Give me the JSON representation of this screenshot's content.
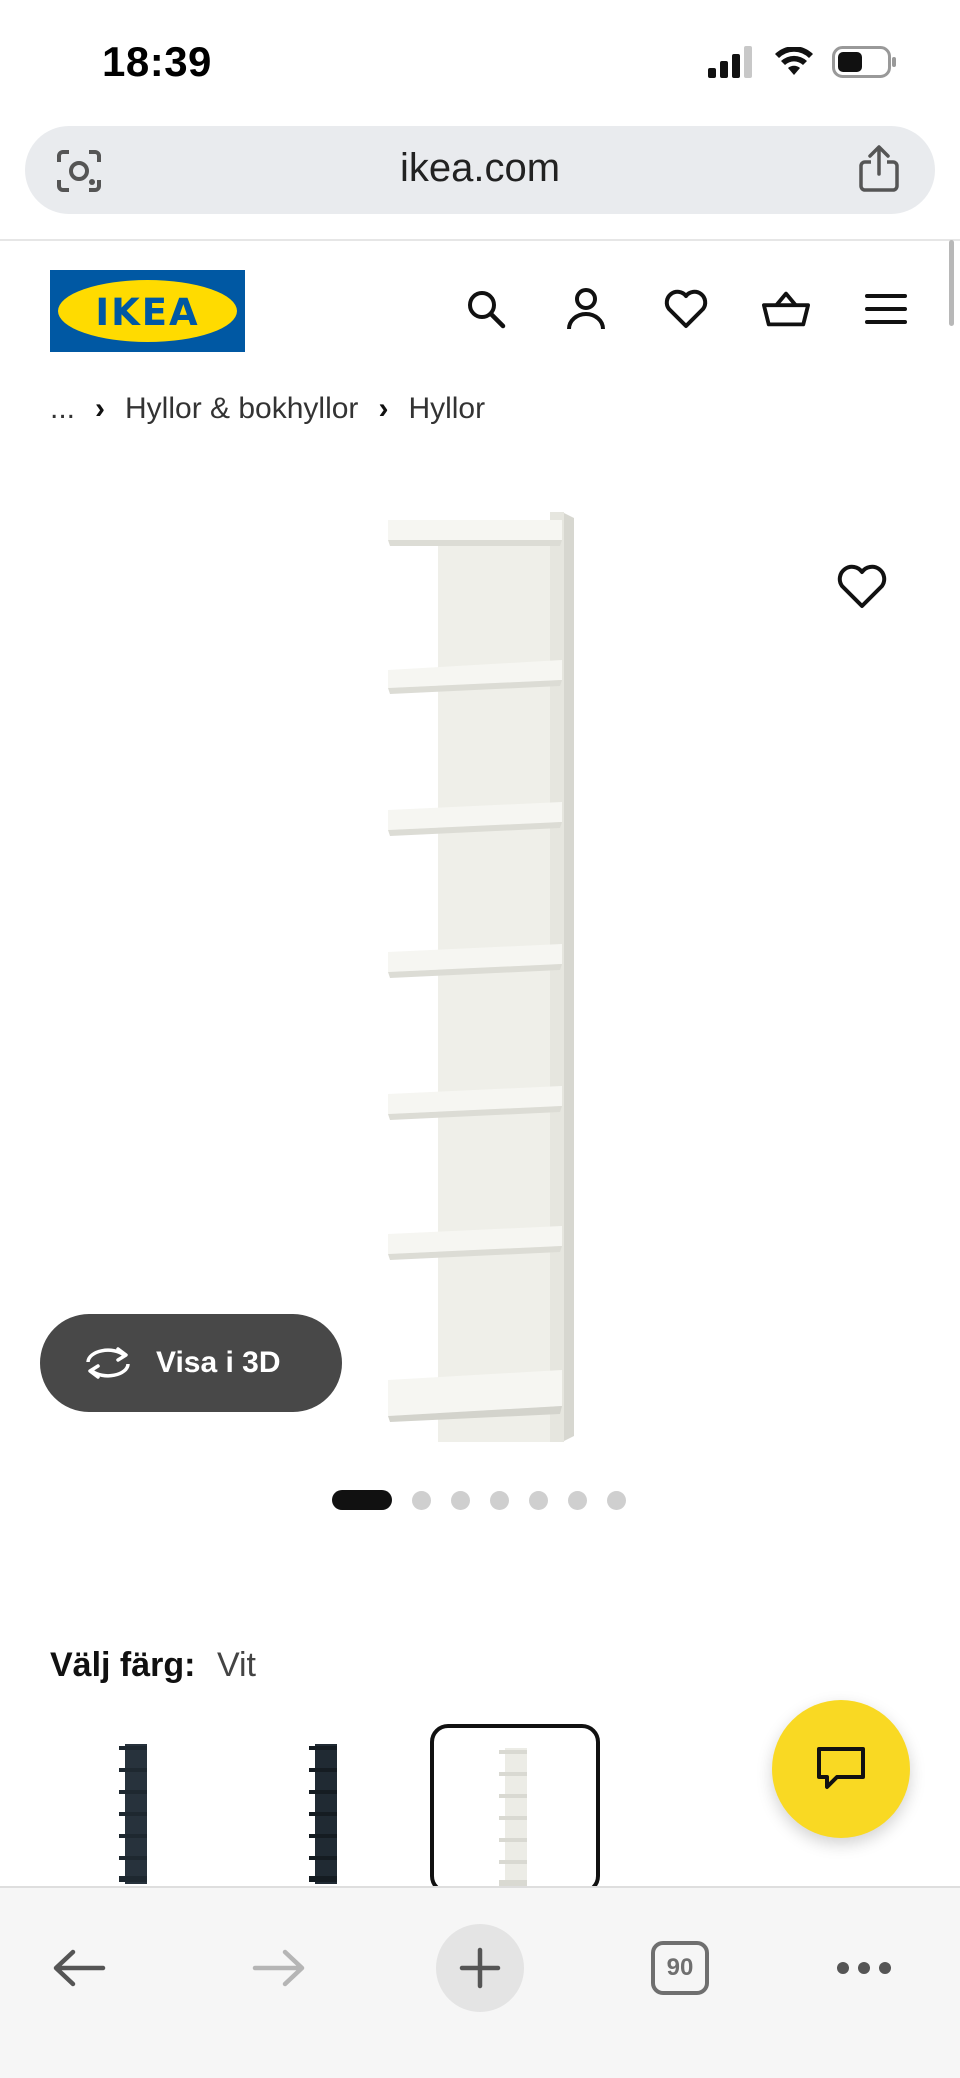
{
  "status_bar": {
    "time": "18:39"
  },
  "browser": {
    "url": "ikea.com",
    "tab_count": "90"
  },
  "header": {
    "logo_text": "IKEA",
    "brand_colors": {
      "blue": "#0058a3",
      "yellow": "#ffdb00"
    }
  },
  "breadcrumb": {
    "ellipsis": "...",
    "items": [
      "Hyllor & bokhyllor",
      "Hyllor"
    ]
  },
  "gallery": {
    "view_3d_label": "Visa i 3D",
    "image_count": 7,
    "active_index": 0
  },
  "color_picker": {
    "label": "Välj färg:",
    "selected": "Vit",
    "options": [
      {
        "color": "#27323c"
      },
      {
        "color": "#202a33"
      },
      {
        "color": "#f2f1ea"
      }
    ]
  },
  "chat": {
    "accent": "#f9d923"
  }
}
